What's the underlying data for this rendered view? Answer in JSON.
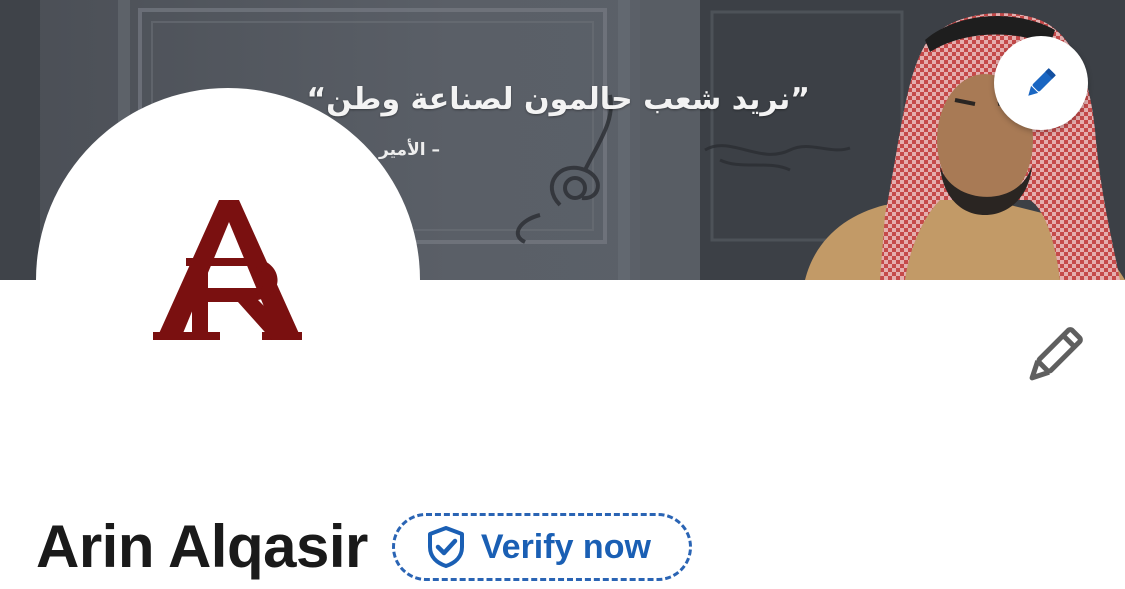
{
  "cover": {
    "quote_text": "”نريد شعب حالمون لصناعة وطن“",
    "attribution_text": "– الأمير",
    "edit_button_icon": "pencil-icon"
  },
  "avatar": {
    "logo_letters": "AR",
    "logo_color": "#7a1010"
  },
  "intro": {
    "edit_icon": "pencil-icon"
  },
  "profile": {
    "name": "Arin Alqasir",
    "verify_label": "Verify now",
    "verify_icon": "shield-check-icon",
    "accent_color": "#1a5fb4"
  }
}
